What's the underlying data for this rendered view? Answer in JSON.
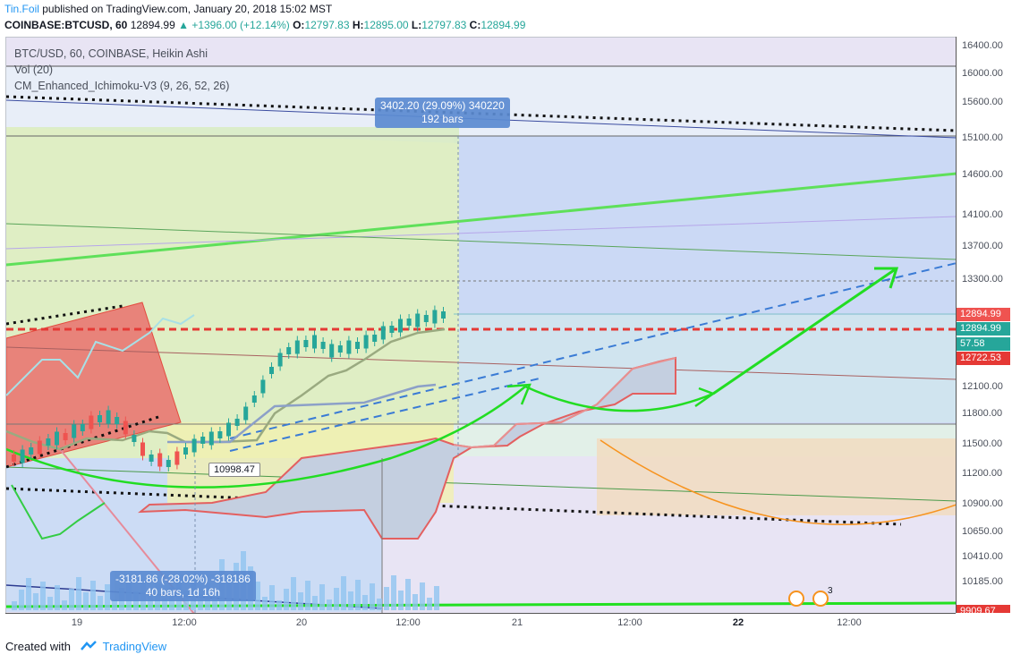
{
  "header": {
    "user": "Tin.Foil",
    "published": " published on TradingView.com, January 20, 2018 15:02 MST",
    "symbol": "COINBASE:BTCUSD, 60",
    "last": "12894.99",
    "change": "▲ +1396.00 (+12.14%)",
    "o_label": "O:",
    "o_value": "12797.83",
    "h_label": "H:",
    "h_value": "12895.00",
    "l_label": "L:",
    "l_value": "12797.83",
    "c_label": "C:",
    "c_value": "12894.99"
  },
  "legend": {
    "main": "BTC/USD, 60, COINBASE, Heikin Ashi",
    "vol": "Vol (20)",
    "ichimoku": "CM_Enhanced_Ichimoku-V3 (9, 26, 52, 26)"
  },
  "price_axis": {
    "ticks": [
      "16400.00",
      "16000.00",
      "15600.00",
      "15100.00",
      "14600.00",
      "14100.00",
      "13700.00",
      "13300.00",
      "12100.00",
      "11800.00",
      "11500.00",
      "11200.00",
      "10900.00",
      "10650.00",
      "10410.00",
      "10185.00"
    ],
    "badges": [
      {
        "text": "12894.99",
        "color": "#ef5350"
      },
      {
        "text": "12894.99",
        "color": "#26a69a"
      },
      {
        "text": "57.58",
        "color": "#26a69a"
      },
      {
        "text": "12722.53",
        "color": "#e53935"
      },
      {
        "text": "9909.67",
        "color": "#e53935"
      }
    ]
  },
  "time_axis": [
    "19",
    "12:00",
    "20",
    "12:00",
    "21",
    "12:00",
    "22",
    "12:00"
  ],
  "annotations": {
    "measure_up_line1": "3402.20 (29.09%) 340220",
    "measure_up_line2": "192 bars",
    "measure_down_line1": "-3181.86 (-28.02%) -318186",
    "measure_down_line2": "40 bars, 1d 16h",
    "price_label": "10998.47",
    "event_count": "3"
  },
  "footer": {
    "created": "Created with",
    "brand": "TradingView"
  },
  "colors": {
    "bull": "#26a69a",
    "bear": "#ef5350",
    "accent": "#2196f3"
  }
}
